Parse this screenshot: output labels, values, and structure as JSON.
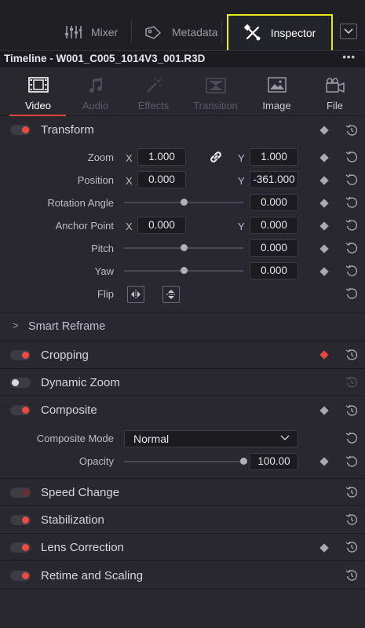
{
  "top_tabs": {
    "mixer_label": "Mixer",
    "metadata_label": "Metadata",
    "inspector_label": "Inspector"
  },
  "title": "Timeline - W001_C005_1014V3_001.R3D",
  "title_menu": "•••",
  "tabs": [
    {
      "label": "Video",
      "state": "active"
    },
    {
      "label": "Audio",
      "state": "disabled"
    },
    {
      "label": "Effects",
      "state": "disabled"
    },
    {
      "label": "Transition",
      "state": "disabled"
    },
    {
      "label": "Image",
      "state": "normal"
    },
    {
      "label": "File",
      "state": "normal"
    }
  ],
  "transform": {
    "label": "Transform",
    "enabled": true,
    "zoom": {
      "label": "Zoom",
      "x_axis": "X",
      "y_axis": "Y",
      "x": "1.000",
      "y": "1.000"
    },
    "position": {
      "label": "Position",
      "x_axis": "X",
      "y_axis": "Y",
      "x": "0.000",
      "y": "-361.000"
    },
    "rotation": {
      "label": "Rotation Angle",
      "value": "0.000"
    },
    "anchor": {
      "label": "Anchor Point",
      "x_axis": "X",
      "y_axis": "Y",
      "x": "0.000",
      "y": "0.000"
    },
    "pitch": {
      "label": "Pitch",
      "value": "0.000"
    },
    "yaw": {
      "label": "Yaw",
      "value": "0.000"
    },
    "flip": {
      "label": "Flip"
    }
  },
  "smart_reframe": {
    "label": "Smart Reframe",
    "chevron": ">"
  },
  "cropping": {
    "label": "Cropping",
    "enabled": true
  },
  "dynamic_zoom": {
    "label": "Dynamic Zoom",
    "enabled": false
  },
  "composite": {
    "label": "Composite",
    "enabled": true,
    "mode_label": "Composite Mode",
    "mode_value": "Normal",
    "opacity_label": "Opacity",
    "opacity_value": "100.00",
    "opacity_fraction": 1.0
  },
  "speed_change": {
    "label": "Speed Change",
    "enabled": false
  },
  "stabilization": {
    "label": "Stabilization",
    "enabled": true
  },
  "lens_correction": {
    "label": "Lens Correction",
    "enabled": true
  },
  "retime_scaling": {
    "label": "Retime and Scaling",
    "enabled": true
  },
  "colors": {
    "accent_red": "#e2463f",
    "highlight_yellow": "#e6ea1a",
    "panel_bg": "#28282e"
  }
}
